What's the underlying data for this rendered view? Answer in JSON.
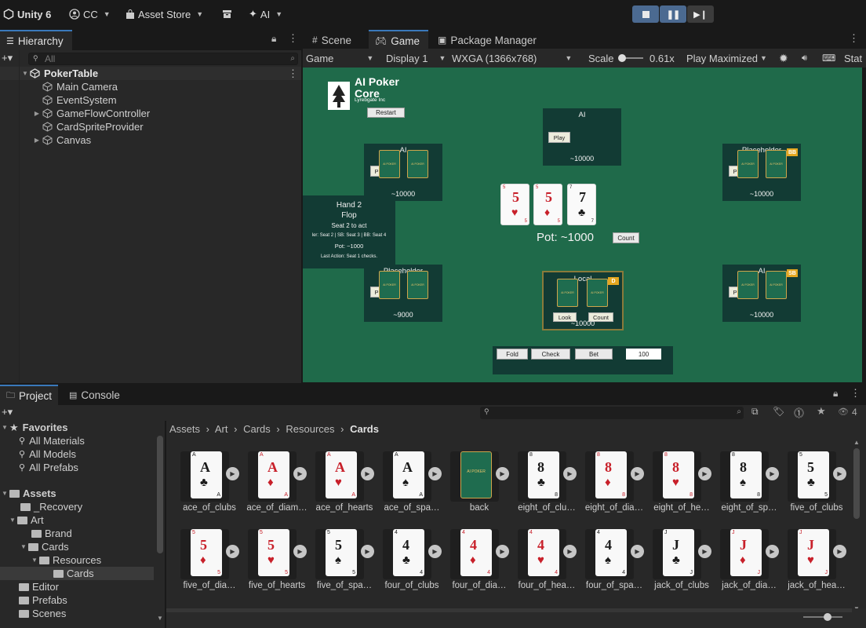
{
  "topbar": {
    "app_name": "Unity 6",
    "account": "CC",
    "asset_store": "Asset Store",
    "ai": "AI"
  },
  "hierarchy": {
    "tab": "Hierarchy",
    "search_placeholder": "All",
    "root": "PokerTable",
    "children": [
      "Main Camera",
      "EventSystem",
      "GameFlowController",
      "CardSpriteProvider",
      "Canvas"
    ]
  },
  "center_tabs": {
    "scene": "Scene",
    "game": "Game",
    "package_manager": "Package Manager"
  },
  "game_toolbar": {
    "mode": "Game",
    "display": "Display 1",
    "resolution": "WXGA (1366x768)",
    "scale_label": "Scale",
    "scale_value": "0.61x",
    "play_mode": "Play Maximized",
    "stats": "Stat"
  },
  "game": {
    "title_line1": "AI Poker",
    "title_line2": "Core",
    "company": "Lyrebgate Inc",
    "restart": "Restart",
    "seats": {
      "top": {
        "name": "AI",
        "chips": "~10000",
        "button": "Play"
      },
      "left_top": {
        "name": "AI",
        "chips": "~10000",
        "button": "P"
      },
      "right_top": {
        "name": "Placeholder",
        "chips": "~10000",
        "badge": "BB",
        "button": "P"
      },
      "left_bottom": {
        "name": "Placeholder",
        "chips": "~9000",
        "button": "P"
      },
      "local": {
        "name": "Local",
        "chips": "~10000",
        "badge": "D",
        "look": "Look",
        "count": "Count"
      },
      "right_bottom": {
        "name": "AI",
        "chips": "~10000",
        "badge": "SB",
        "button": "P"
      }
    },
    "info": {
      "hand": "Hand 2",
      "street": "Flop",
      "to_act": "Seat 2 to act",
      "blinds": "ler: Seat 2 | SB: Seat 3 | BB: Seat 4",
      "pot": "Pot: ~1000",
      "last_action": "Last Action: Seat 1 checks."
    },
    "board": [
      {
        "rank": "5",
        "suit": "♥",
        "color": "red"
      },
      {
        "rank": "5",
        "suit": "♦",
        "color": "red"
      },
      {
        "rank": "7",
        "suit": "♣",
        "color": "black"
      }
    ],
    "pot": "Pot: ~1000",
    "count_button": "Count",
    "card_back_text": "AI POKER",
    "actions": {
      "fold": "Fold",
      "check": "Check",
      "bet": "Bet",
      "amount": "100"
    }
  },
  "bottom_tabs": {
    "project": "Project",
    "console": "Console"
  },
  "project": {
    "favorites_label": "Favorites",
    "favorites": [
      "All Materials",
      "All Models",
      "All Prefabs"
    ],
    "assets_label": "Assets",
    "tree": [
      {
        "label": "_Recovery",
        "level": 1
      },
      {
        "label": "Art",
        "level": 1
      },
      {
        "label": "Brand",
        "level": 2
      },
      {
        "label": "Cards",
        "level": 2
      },
      {
        "label": "Resources",
        "level": 3
      },
      {
        "label": "Cards",
        "level": 4
      },
      {
        "label": "Editor",
        "level": 1
      },
      {
        "label": "Prefabs",
        "level": 1
      },
      {
        "label": "Scenes",
        "level": 1
      }
    ],
    "breadcrumb": [
      "Assets",
      "Art",
      "Cards",
      "Resources",
      "Cards"
    ],
    "count": "4",
    "assets_row1": [
      {
        "name": "ace_of_clubs",
        "rank": "A",
        "suit": "♣",
        "color": "black"
      },
      {
        "name": "ace_of_diam…",
        "rank": "A",
        "suit": "♦",
        "color": "red"
      },
      {
        "name": "ace_of_hearts",
        "rank": "A",
        "suit": "♥",
        "color": "red"
      },
      {
        "name": "ace_of_spa…",
        "rank": "A",
        "suit": "♠",
        "color": "black"
      },
      {
        "name": "back",
        "rank": "",
        "suit": "",
        "color": "back"
      },
      {
        "name": "eight_of_clu…",
        "rank": "8",
        "suit": "♣",
        "color": "black"
      },
      {
        "name": "eight_of_dia…",
        "rank": "8",
        "suit": "♦",
        "color": "red"
      },
      {
        "name": "eight_of_he…",
        "rank": "8",
        "suit": "♥",
        "color": "red"
      },
      {
        "name": "eight_of_sp…",
        "rank": "8",
        "suit": "♠",
        "color": "black"
      },
      {
        "name": "five_of_clubs",
        "rank": "5",
        "suit": "♣",
        "color": "black"
      }
    ],
    "assets_row2": [
      {
        "name": "five_of_dia…",
        "rank": "5",
        "suit": "♦",
        "color": "red"
      },
      {
        "name": "five_of_hearts",
        "rank": "5",
        "suit": "♥",
        "color": "red"
      },
      {
        "name": "five_of_spa…",
        "rank": "5",
        "suit": "♠",
        "color": "black"
      },
      {
        "name": "four_of_clubs",
        "rank": "4",
        "suit": "♣",
        "color": "black"
      },
      {
        "name": "four_of_dia…",
        "rank": "4",
        "suit": "♦",
        "color": "red"
      },
      {
        "name": "four_of_hea…",
        "rank": "4",
        "suit": "♥",
        "color": "red"
      },
      {
        "name": "four_of_spa…",
        "rank": "4",
        "suit": "♠",
        "color": "black"
      },
      {
        "name": "jack_of_clubs",
        "rank": "J",
        "suit": "♣",
        "color": "black"
      },
      {
        "name": "jack_of_dia…",
        "rank": "J",
        "suit": "♦",
        "color": "red"
      },
      {
        "name": "jack_of_hea…",
        "rank": "J",
        "suit": "♥",
        "color": "red"
      }
    ]
  }
}
